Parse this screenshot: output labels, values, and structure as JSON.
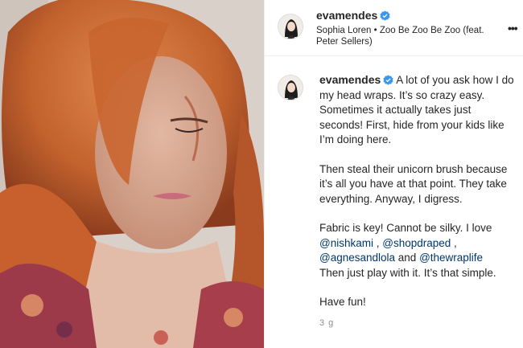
{
  "post": {
    "username": "evamendes",
    "music": "Sophia Loren • Zoo Be Zoo Be Zoo (feat. Peter Sellers)",
    "more_label": "•••",
    "caption": {
      "p1": "A lot of you ask how I do my head wraps. It’s so crazy easy. Sometimes it actually takes just seconds! First, hide from your kids like I’m doing here.",
      "p2": "Then steal their unicorn brush because it’s all you have at that point. They take everything. Anyway, I digress.",
      "p3_text": "Fabric is key! Cannot be silky. I love",
      "mention1": "@nishkami",
      "sep1": " , ",
      "mention2": "@shopdraped",
      "sep2": " , ",
      "mention3": "@agnesandlola",
      "and": " and ",
      "mention4": "@thewraplife",
      "p3_end": "Then just play with it. It’s that simple.",
      "p4": "Have fun!"
    },
    "time": "3 g"
  },
  "colors": {
    "verified": "#3897f0",
    "link": "#00376b",
    "muted": "#8e8e8e"
  },
  "icons": [
    "verified-badge-icon",
    "more-options-icon"
  ]
}
